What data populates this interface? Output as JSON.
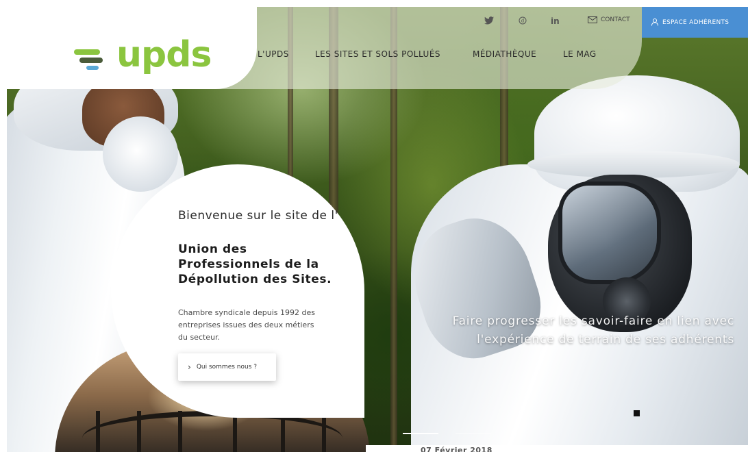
{
  "header": {
    "logo_text": "upds",
    "nav": [
      {
        "label": "L'UPDS"
      },
      {
        "label": "LES SITES ET SOLS POLLUÉS"
      },
      {
        "label": "MÉDIATHÈQUE"
      },
      {
        "label": "LE MAG"
      }
    ],
    "social": [
      {
        "icon": "twitter-icon",
        "glyph": "🐦"
      },
      {
        "icon": "dailymotion-icon",
        "glyph": "ⓓ"
      },
      {
        "icon": "linkedin-icon",
        "glyph": "in"
      }
    ],
    "contact_label": "CONTACT",
    "members_label": "ESPACE ADHÉRENTS"
  },
  "welcome": {
    "intro": "Bienvenue sur le site de l'",
    "organization": "Union des Professionnels de la Dépollution des Sites.",
    "description": "Chambre syndicale depuis 1992 des entreprises issues des deux métiers du secteur.",
    "cta_label": "Qui sommes nous ?"
  },
  "slider": {
    "caption": "Faire progresser les savoir-faire en lien avec l'expérience de terrain de ses adhérents"
  },
  "news": {
    "date": "07 Février 2018"
  },
  "colors": {
    "brand_green": "#8bc53f",
    "accent_blue": "#4a8fd3",
    "logo_dark": "#4a5b3a",
    "logo_blue": "#5aa9d6"
  }
}
